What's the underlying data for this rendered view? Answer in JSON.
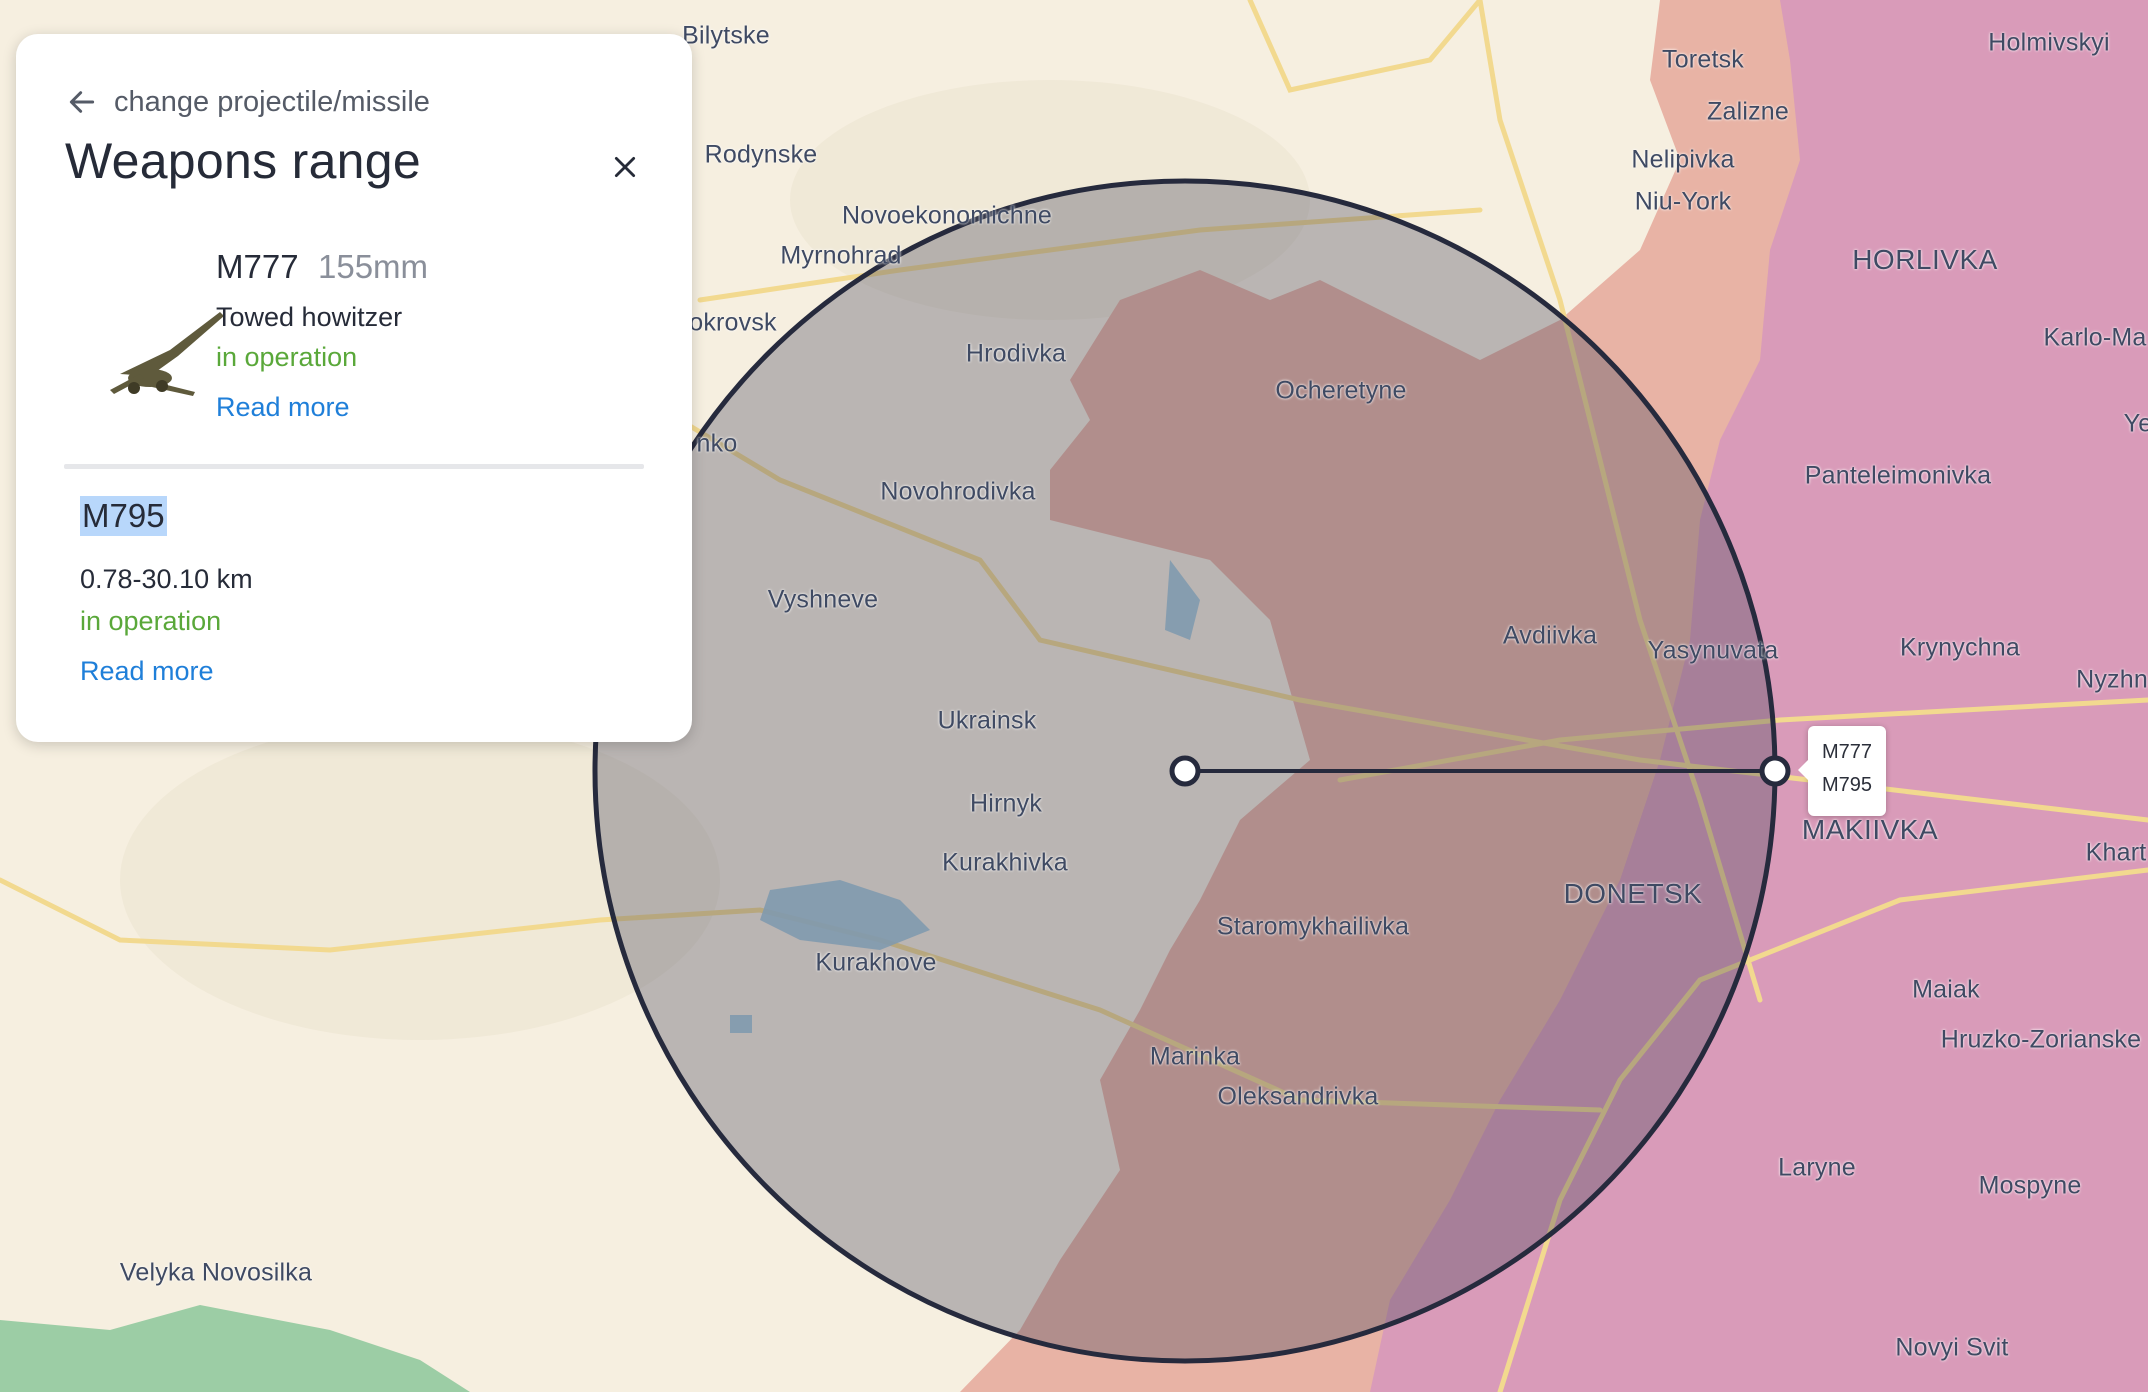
{
  "panel": {
    "back_label": "change projectile/missile",
    "title": "Weapons range",
    "weapon": {
      "name": "M777",
      "caliber": "155mm",
      "type": "Towed howitzer",
      "status": "in operation",
      "read_more": "Read more"
    },
    "projectile": {
      "name": "M795",
      "range": "0.78-30.10 km",
      "status": "in operation",
      "read_more": "Read more"
    }
  },
  "range_marker": {
    "weapon": "M777",
    "projectile": "M795"
  },
  "places": {
    "bilytske": "Bilytske",
    "rodynske": "Rodynske",
    "novoekonomichne": "Novoekonomichne",
    "myrnohrad": "Myrnohrad",
    "pokrovsk": "okrovsk",
    "hrodivka": "Hrodivka",
    "ocheretyne": "Ocheretyne",
    "nko": "nko",
    "novohrodivka": "Novohrodivka",
    "vyshneve": "Vyshneve",
    "avdiivka": "Avdiivka",
    "yasynuvata": "Yasynuvata",
    "ukrainsk": "Ukrainsk",
    "hirnyk": "Hirnyk",
    "kurakhivka": "Kurakhivka",
    "kurakhove": "Kurakhove",
    "staromykhailivka": "Staromykhailivka",
    "donetsk": "DONETSK",
    "marinka": "Marinka",
    "oleksandrivka": "Oleksandrivka",
    "velyka_novosilka": "Velyka Novosilka",
    "toretsk": "Toretsk",
    "zalizne": "Zalizne",
    "nelipivka": "Nelipivka",
    "niu_york": "Niu-York",
    "holmivskyi": "Holmivskyi",
    "horlivka": "HORLIVKA",
    "karlo_ma": "Karlo-Ma",
    "ye": "Ye",
    "panteleimonivka": "Panteleimonivka",
    "krynychna": "Krynychna",
    "nyzhn": "Nyzhn",
    "makiivka": "MAKIIVKA",
    "khart": "Khart",
    "maiak": "Maiak",
    "hruzko_zorianske": "Hruzko-Zorianske",
    "laryne": "Laryne",
    "mospyne": "Mospyne",
    "novyi_svit": "Novyi Svit"
  },
  "colors": {
    "land": "#f6efe0",
    "occupied_zone": "#e8b3a5",
    "occupied_long_term": "#d99bb9",
    "range_circle_fill": "#4a4a5e",
    "range_circle_stroke": "#262a3d",
    "road": "#f2d98f",
    "status_green": "#5aa83a",
    "link_blue": "#1f7fd9",
    "highlight": "#b8d7fb"
  },
  "icons": {
    "back": "arrow-left-icon",
    "close": "close-icon",
    "weapon": "howitzer-icon"
  }
}
